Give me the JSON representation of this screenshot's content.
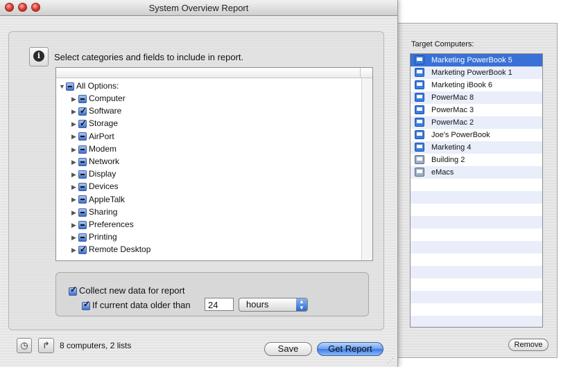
{
  "window": {
    "title": "System Overview Report",
    "instruction": "Select categories and fields to include in report.",
    "info_icon_glyph": "i"
  },
  "tree": {
    "root": {
      "label": "All Options:",
      "state": "mixed",
      "expanded": true
    },
    "items": [
      {
        "label": "Computer",
        "state": "mixed"
      },
      {
        "label": "Software",
        "state": "checked"
      },
      {
        "label": "Storage",
        "state": "checked"
      },
      {
        "label": "AirPort",
        "state": "mixed"
      },
      {
        "label": "Modem",
        "state": "mixed"
      },
      {
        "label": "Network",
        "state": "mixed"
      },
      {
        "label": "Display",
        "state": "mixed"
      },
      {
        "label": "Devices",
        "state": "mixed"
      },
      {
        "label": "AppleTalk",
        "state": "mixed"
      },
      {
        "label": "Sharing",
        "state": "mixed"
      },
      {
        "label": "Preferences",
        "state": "mixed"
      },
      {
        "label": "Printing",
        "state": "mixed"
      },
      {
        "label": "Remote Desktop",
        "state": "checked"
      }
    ]
  },
  "options": {
    "collect_label": "Collect new data for report",
    "collect_checked": true,
    "older_label": "If current data older than",
    "older_checked": true,
    "older_value": "24",
    "unit_selected": "hours"
  },
  "footer": {
    "status": "8 computers, 2 lists",
    "save_label": "Save",
    "get_report_label": "Get Report"
  },
  "drawer": {
    "title": "Target Computers:",
    "computers": [
      {
        "name": "Marketing PowerBook 5",
        "kind": "computer",
        "selected": true
      },
      {
        "name": "Marketing PowerBook 1",
        "kind": "computer",
        "selected": false
      },
      {
        "name": "Marketing iBook 6",
        "kind": "computer",
        "selected": false
      },
      {
        "name": "PowerMac 8",
        "kind": "computer",
        "selected": false
      },
      {
        "name": "PowerMac 3",
        "kind": "computer",
        "selected": false
      },
      {
        "name": "PowerMac 2",
        "kind": "computer",
        "selected": false
      },
      {
        "name": "Joe's PowerBook",
        "kind": "computer",
        "selected": false
      },
      {
        "name": "Marketing 4",
        "kind": "computer",
        "selected": false
      },
      {
        "name": "Building 2",
        "kind": "list",
        "selected": false
      },
      {
        "name": "eMacs",
        "kind": "list",
        "selected": false
      }
    ],
    "remove_label": "Remove"
  },
  "colors": {
    "selection": "#3a71d6",
    "accent_button": "#3a7be6"
  }
}
